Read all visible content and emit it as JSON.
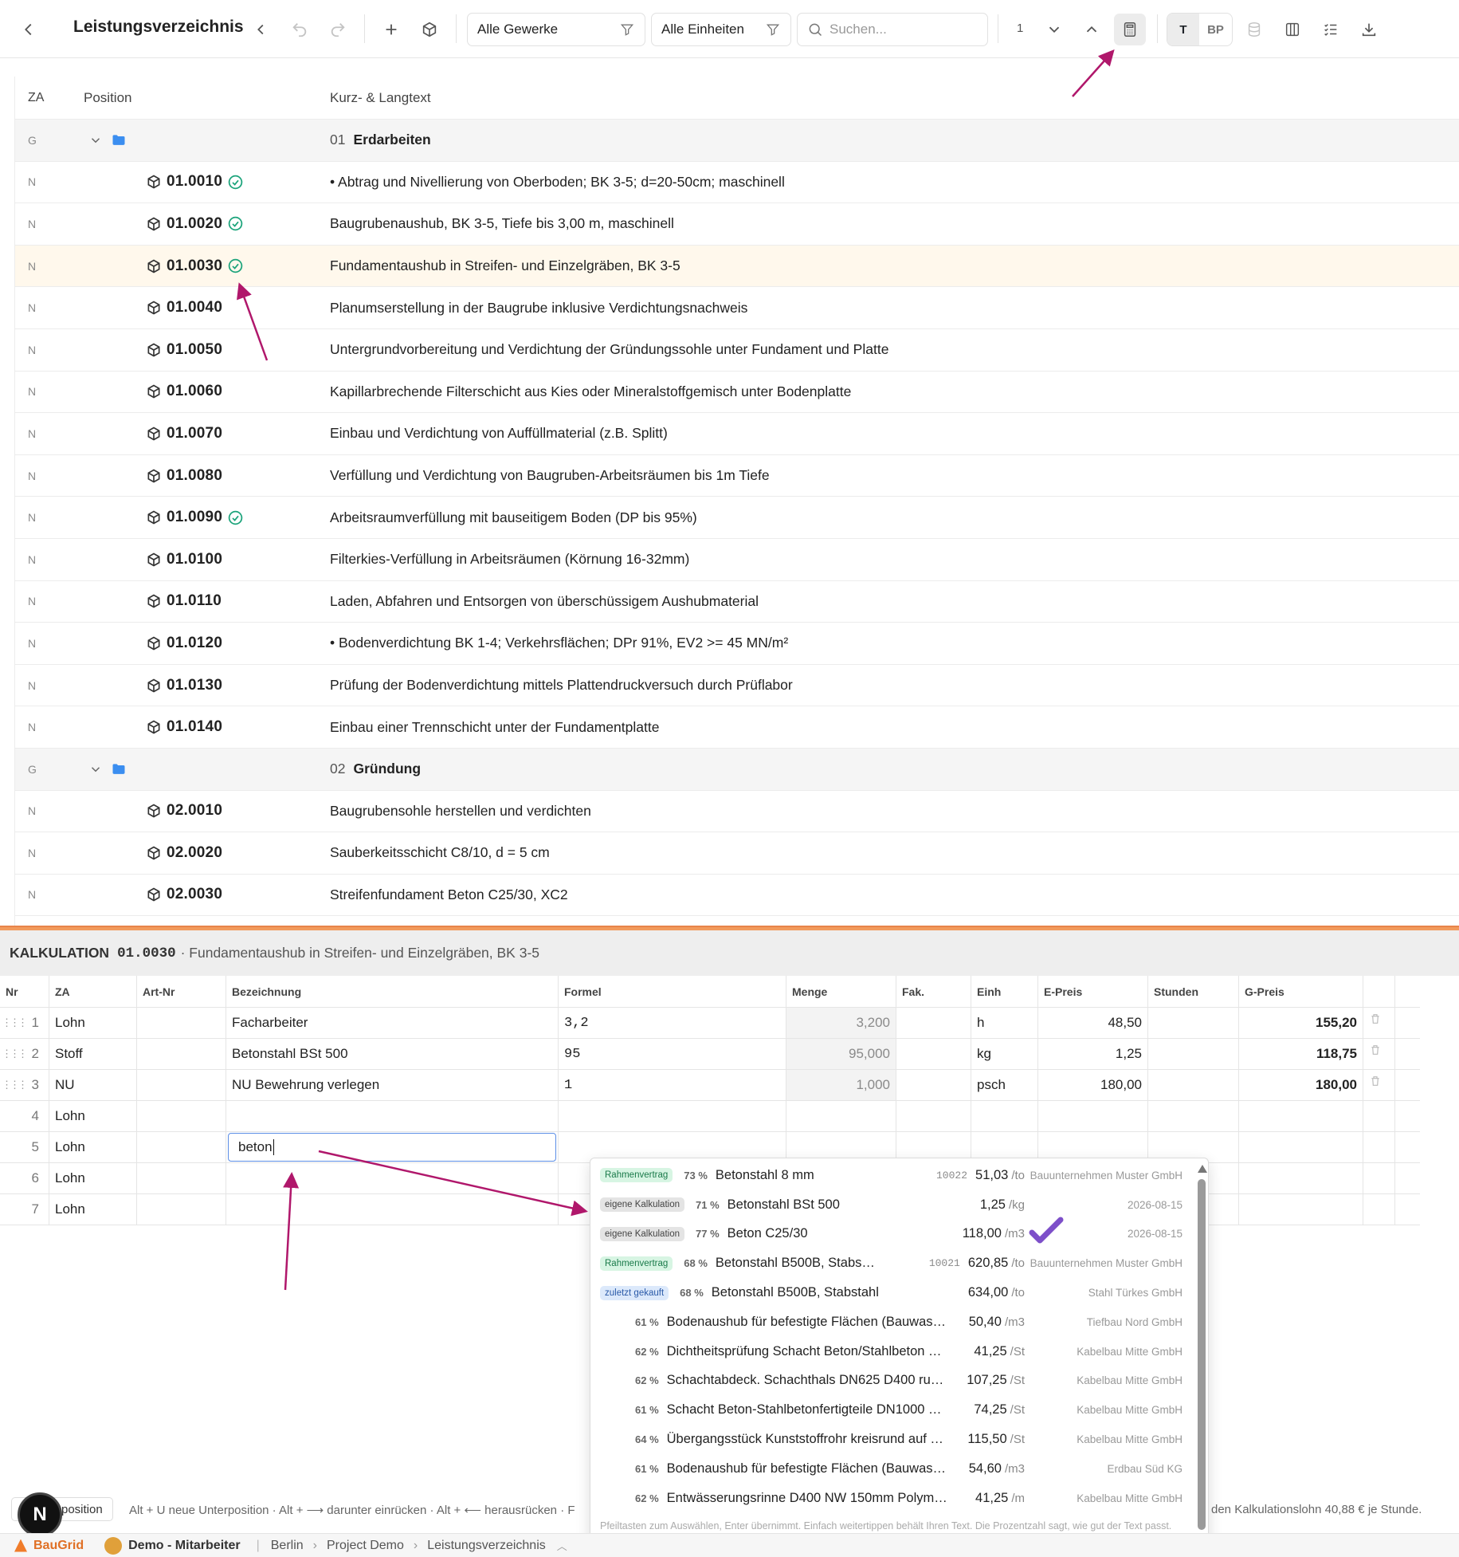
{
  "toolbar": {
    "title": "Leistungsverzeichnis",
    "filter_gewerke": "Alle Gewerke",
    "filter_einheiten": "Alle Einheiten",
    "search_placeholder": "Suchen...",
    "match_count": "1",
    "btn_t": "T",
    "btn_bp": "BP"
  },
  "grid": {
    "headers": {
      "za": "ZA",
      "position": "Position",
      "text": "Kurz- & Langtext"
    },
    "rows": [
      {
        "za": "G",
        "num": "01",
        "text": "Erdarbeiten",
        "group": true
      },
      {
        "za": "N",
        "pos": "01.0010",
        "check": true,
        "text": "• Abtrag und Nivellierung von Oberboden; BK 3-5; d=20-50cm; maschinell"
      },
      {
        "za": "N",
        "pos": "01.0020",
        "check": true,
        "text": "Baugrubenaushub, BK 3-5, Tiefe bis 3,00 m, maschinell"
      },
      {
        "za": "N",
        "pos": "01.0030",
        "check": true,
        "selected": true,
        "text": "Fundamentaushub in Streifen- und Einzelgräben, BK 3-5"
      },
      {
        "za": "N",
        "pos": "01.0040",
        "text": "Planumserstellung in der Baugrube inklusive Verdichtungsnachweis"
      },
      {
        "za": "N",
        "pos": "01.0050",
        "text": "Untergrundvorbereitung und Verdichtung der Gründungssohle unter Fundament und Platte"
      },
      {
        "za": "N",
        "pos": "01.0060",
        "text": "Kapillarbrechende Filterschicht aus Kies oder Mineralstoffgemisch unter Bodenplatte"
      },
      {
        "za": "N",
        "pos": "01.0070",
        "text": "Einbau und Verdichtung von Auffüllmaterial (z.B. Splitt)"
      },
      {
        "za": "N",
        "pos": "01.0080",
        "text": "Verfüllung und Verdichtung von Baugruben-Arbeitsräumen bis 1m Tiefe"
      },
      {
        "za": "N",
        "pos": "01.0090",
        "check": true,
        "text": "Arbeitsraumverfüllung mit bauseitigem Boden (DP bis 95%)"
      },
      {
        "za": "N",
        "pos": "01.0100",
        "text": "Filterkies-Verfüllung in Arbeitsräumen (Körnung 16-32mm)"
      },
      {
        "za": "N",
        "pos": "01.0110",
        "text": "Laden, Abfahren und Entsorgen von überschüssigem Aushubmaterial"
      },
      {
        "za": "N",
        "pos": "01.0120",
        "text": "• Bodenverdichtung BK 1-4; Verkehrsflächen; DPr 91%, EV2 >= 45 MN/m²"
      },
      {
        "za": "N",
        "pos": "01.0130",
        "text": "Prüfung der Bodenverdichtung mittels Plattendruckversuch durch Prüflabor"
      },
      {
        "za": "N",
        "pos": "01.0140",
        "text": "Einbau einer Trennschicht unter der Fundamentplatte"
      },
      {
        "za": "G",
        "num": "02",
        "text": "Gründung",
        "group": true
      },
      {
        "za": "N",
        "pos": "02.0010",
        "text": "Baugrubensohle herstellen und verdichten"
      },
      {
        "za": "N",
        "pos": "02.0020",
        "text": "Sauberkeitsschicht C8/10, d = 5 cm"
      },
      {
        "za": "N",
        "pos": "02.0030",
        "text": "Streifenfundament Beton C25/30, XC2"
      }
    ]
  },
  "kalkulation": {
    "label": "KALKULATION",
    "pos": "01.0030",
    "title": "· Fundamentaushub in Streifen- und Einzelgräben, BK 3-5",
    "headers": [
      "Nr",
      "ZA",
      "Art-Nr",
      "Bezeichnung",
      "Formel",
      "Menge",
      "Fak.",
      "Einh",
      "E-Preis",
      "Stunden",
      "G-Preis"
    ],
    "rows": [
      {
        "nr": "1",
        "za": "Lohn",
        "art": "",
        "bez": "Facharbeiter",
        "formel": "3,2",
        "menge": "3,200",
        "fak": "",
        "einh": "h",
        "epreis": "48,50",
        "std": "",
        "gpreis": "155,20",
        "handle": true
      },
      {
        "nr": "2",
        "za": "Stoff",
        "art": "",
        "bez": "Betonstahl BSt 500",
        "formel": "95",
        "menge": "95,000",
        "fak": "",
        "einh": "kg",
        "epreis": "1,25",
        "std": "",
        "gpreis": "118,75",
        "handle": true
      },
      {
        "nr": "3",
        "za": "NU",
        "art": "",
        "bez": "NU Bewehrung verlegen",
        "formel": "1",
        "menge": "1,000",
        "fak": "",
        "einh": "psch",
        "epreis": "180,00",
        "std": "",
        "gpreis": "180,00",
        "handle": true
      },
      {
        "nr": "4",
        "za": "Lohn",
        "art": "",
        "bez": "",
        "formel": "",
        "menge": "",
        "fak": "",
        "einh": "",
        "epreis": "",
        "std": "",
        "gpreis": ""
      },
      {
        "nr": "5",
        "za": "Lohn",
        "art": "",
        "bez": "",
        "formel": "",
        "menge": "",
        "fak": "",
        "einh": "",
        "epreis": "",
        "std": "",
        "gpreis": "",
        "editing": true
      },
      {
        "nr": "6",
        "za": "Lohn",
        "art": "",
        "bez": "",
        "formel": "",
        "menge": "",
        "fak": "",
        "einh": "",
        "epreis": "",
        "std": "",
        "gpreis": ""
      },
      {
        "nr": "7",
        "za": "Lohn",
        "art": "",
        "bez": "",
        "formel": "",
        "menge": "",
        "fak": "",
        "einh": "",
        "epreis": "",
        "std": "",
        "gpreis": ""
      }
    ],
    "input_value": "beton"
  },
  "suggestions": [
    {
      "badge": "Rahmenvertrag",
      "badge_color": "#d7f5e3",
      "badge_text": "#1a7a4a",
      "pct": "73 %",
      "name": "Betonstahl 8 mm",
      "art": "10022",
      "price": "51,03",
      "unit": "/to",
      "supplier": "Bauunternehmen Muster GmbH"
    },
    {
      "badge": "eigene Kalkulation",
      "badge_color": "#e4e4e4",
      "badge_text": "#444",
      "pct": "71 %",
      "name": "Betonstahl BSt 500",
      "art": "",
      "price": "1,25",
      "unit": "/kg",
      "supplier": "2026-08-15"
    },
    {
      "badge": "eigene Kalkulation",
      "badge_color": "#e4e4e4",
      "badge_text": "#444",
      "pct": "77 %",
      "name": "Beton C25/30",
      "art": "",
      "price": "118,00",
      "unit": "/m3",
      "supplier": "2026-08-15",
      "checkmark": true
    },
    {
      "badge": "Rahmenvertrag",
      "badge_color": "#d7f5e3",
      "badge_text": "#1a7a4a",
      "pct": "68 %",
      "name": "Betonstahl B500B, Stabstahl",
      "art": "10021",
      "price": "620,85",
      "unit": "/to",
      "supplier": "Bauunternehmen Muster GmbH"
    },
    {
      "badge": "zuletzt gekauft",
      "badge_color": "#dce9fb",
      "badge_text": "#2a5aa8",
      "pct": "68 %",
      "name": "Betonstahl B500B, Stabstahl",
      "art": "",
      "price": "634,00",
      "unit": "/to",
      "supplier": "Stahl Türkes GmbH"
    },
    {
      "badge": "",
      "pct": "61 %",
      "name": "Bodenaushub für befestigte Flächen (Bauwas…",
      "art": "",
      "price": "50,40",
      "unit": "/m3",
      "supplier": "Tiefbau Nord GmbH"
    },
    {
      "badge": "",
      "pct": "62 %",
      "name": "Dichtheitsprüfung Schacht Beton/Stahlbeton D…",
      "art": "",
      "price": "41,25",
      "unit": "/St",
      "supplier": "Kabelbau Mitte GmbH"
    },
    {
      "badge": "",
      "pct": "62 %",
      "name": "Schachtabdeck. Schachthals DN625 D400 ru…",
      "art": "",
      "price": "107,25",
      "unit": "/St",
      "supplier": "Kabelbau Mitte GmbH"
    },
    {
      "badge": "",
      "pct": "61 %",
      "name": "Schacht Beton-Stahlbetonfertigteile DN1000 S…",
      "art": "",
      "price": "74,25",
      "unit": "/St",
      "supplier": "Kabelbau Mitte GmbH"
    },
    {
      "badge": "",
      "pct": "64 %",
      "name": "Übergangsstück Kunststoffrohr kreisrund auf …",
      "art": "",
      "price": "115,50",
      "unit": "/St",
      "supplier": "Kabelbau Mitte GmbH"
    },
    {
      "badge": "",
      "pct": "61 %",
      "name": "Bodenaushub für befestigte Flächen (Bauwas…",
      "art": "",
      "price": "54,60",
      "unit": "/m3",
      "supplier": "Erdbau Süd KG"
    },
    {
      "badge": "",
      "pct": "62 %",
      "name": "Entwässerungsrinne D400 NW 150mm Polym…",
      "art": "",
      "price": "41,25",
      "unit": "/m",
      "supplier": "Kabelbau Mitte GmbH"
    }
  ],
  "suggest_hint": "Pfeiltasten zum Auswählen, Enter übernimmt. Einfach weitertippen behält Ihren Text. Die Prozentzahl sagt, wie gut der Text passt.",
  "shortcuts": {
    "chip": "position",
    "text": "Alt + U neue Unterposition · Alt + ⟶ darunter einrücken · Alt + ⟵ herausrücken · F",
    "right": "den Kalkulationslohn 40,88 € je Stunde."
  },
  "statusbar": {
    "brand": "BauGrid",
    "user": "Demo - Mitarbeiter",
    "crumbs": [
      "Berlin",
      "Project Demo",
      "Leistungsverzeichnis"
    ],
    "avatar": "N"
  },
  "colors": {
    "accent": "#b0176b",
    "check": "#1aa37a",
    "folder": "#3b8ef0",
    "kz_bar": "#f29a5c"
  }
}
